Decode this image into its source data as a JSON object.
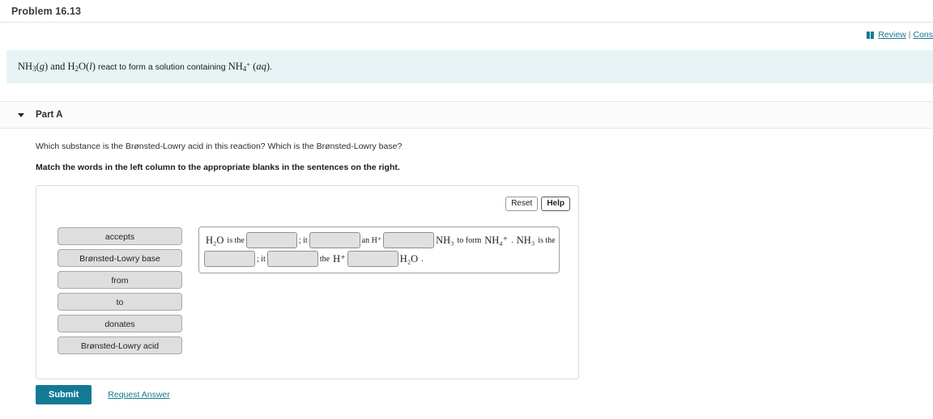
{
  "header": {
    "problem_title": "Problem 16.13"
  },
  "utility": {
    "review_icon": "book-icon",
    "review_label": "Review",
    "separator": "|",
    "constants_label": "Cons"
  },
  "statement": {
    "parts": [
      {
        "type": "chem",
        "text": "NH3(g)"
      },
      {
        "type": "plain",
        "text": " and "
      },
      {
        "type": "chem",
        "text": "H2O(l)"
      },
      {
        "type": "plain",
        "text": " react to form a solution containing "
      },
      {
        "type": "chem",
        "text": "NH4+ (aq)"
      },
      {
        "type": "plain",
        "text": "."
      }
    ]
  },
  "part": {
    "caret": "chevron-down-icon",
    "label": "Part A"
  },
  "question": {
    "prompt": "Which substance is the Brønsted-Lowry acid in this reaction? Which is the Brønsted-Lowry base?",
    "instruction": "Match the words in the left column to the appropriate blanks in the sentences on the right."
  },
  "toolbar": {
    "reset_label": "Reset",
    "help_label": "Help"
  },
  "word_bank": {
    "items": [
      {
        "label": "accepts"
      },
      {
        "label": "Brønsted-Lowry base"
      },
      {
        "label": "from"
      },
      {
        "label": "to"
      },
      {
        "label": "donates"
      },
      {
        "label": "Brønsted-Lowry acid"
      }
    ]
  },
  "sentence": {
    "line1": {
      "t1": "H₂O",
      "t2": "is the",
      "blank1": "",
      "t3": "; it",
      "blank2": "",
      "t4": "an H⁺",
      "blank3": "",
      "t5": "NH₃",
      "t6": "to form",
      "t7": "NH₄⁺",
      "t8": ".",
      "t9": "NH₃",
      "t10": "is the"
    },
    "line2": {
      "blank4": "",
      "t1": "; it",
      "blank5": "",
      "t2": "the",
      "t3": "H⁺",
      "blank6": "",
      "t4": "H₂O",
      "t5": "."
    }
  },
  "actions": {
    "submit_label": "Submit",
    "request_answer_label": "Request Answer"
  },
  "colors": {
    "accent_teal": "#16798f",
    "submit_bg": "#137a96",
    "banner_bg": "#e7f3f4",
    "chip_bg": "#dedede",
    "blank_bg": "#e0e0e0"
  }
}
